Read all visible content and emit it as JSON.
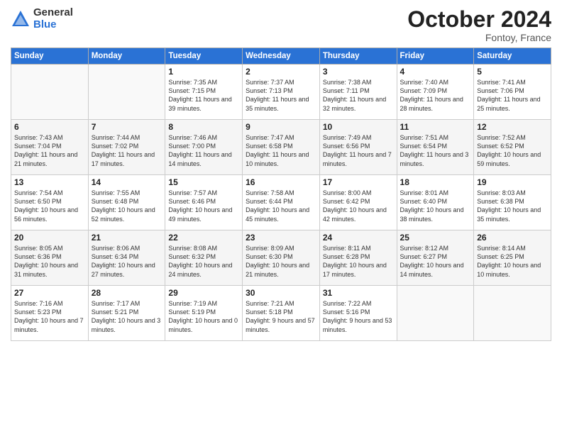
{
  "logo": {
    "general": "General",
    "blue": "Blue"
  },
  "title": "October 2024",
  "location": "Fontoy, France",
  "days_of_week": [
    "Sunday",
    "Monday",
    "Tuesday",
    "Wednesday",
    "Thursday",
    "Friday",
    "Saturday"
  ],
  "weeks": [
    [
      {
        "day": "",
        "info": ""
      },
      {
        "day": "",
        "info": ""
      },
      {
        "day": "1",
        "info": "Sunrise: 7:35 AM\nSunset: 7:15 PM\nDaylight: 11 hours and 39 minutes."
      },
      {
        "day": "2",
        "info": "Sunrise: 7:37 AM\nSunset: 7:13 PM\nDaylight: 11 hours and 35 minutes."
      },
      {
        "day": "3",
        "info": "Sunrise: 7:38 AM\nSunset: 7:11 PM\nDaylight: 11 hours and 32 minutes."
      },
      {
        "day": "4",
        "info": "Sunrise: 7:40 AM\nSunset: 7:09 PM\nDaylight: 11 hours and 28 minutes."
      },
      {
        "day": "5",
        "info": "Sunrise: 7:41 AM\nSunset: 7:06 PM\nDaylight: 11 hours and 25 minutes."
      }
    ],
    [
      {
        "day": "6",
        "info": "Sunrise: 7:43 AM\nSunset: 7:04 PM\nDaylight: 11 hours and 21 minutes."
      },
      {
        "day": "7",
        "info": "Sunrise: 7:44 AM\nSunset: 7:02 PM\nDaylight: 11 hours and 17 minutes."
      },
      {
        "day": "8",
        "info": "Sunrise: 7:46 AM\nSunset: 7:00 PM\nDaylight: 11 hours and 14 minutes."
      },
      {
        "day": "9",
        "info": "Sunrise: 7:47 AM\nSunset: 6:58 PM\nDaylight: 11 hours and 10 minutes."
      },
      {
        "day": "10",
        "info": "Sunrise: 7:49 AM\nSunset: 6:56 PM\nDaylight: 11 hours and 7 minutes."
      },
      {
        "day": "11",
        "info": "Sunrise: 7:51 AM\nSunset: 6:54 PM\nDaylight: 11 hours and 3 minutes."
      },
      {
        "day": "12",
        "info": "Sunrise: 7:52 AM\nSunset: 6:52 PM\nDaylight: 10 hours and 59 minutes."
      }
    ],
    [
      {
        "day": "13",
        "info": "Sunrise: 7:54 AM\nSunset: 6:50 PM\nDaylight: 10 hours and 56 minutes."
      },
      {
        "day": "14",
        "info": "Sunrise: 7:55 AM\nSunset: 6:48 PM\nDaylight: 10 hours and 52 minutes."
      },
      {
        "day": "15",
        "info": "Sunrise: 7:57 AM\nSunset: 6:46 PM\nDaylight: 10 hours and 49 minutes."
      },
      {
        "day": "16",
        "info": "Sunrise: 7:58 AM\nSunset: 6:44 PM\nDaylight: 10 hours and 45 minutes."
      },
      {
        "day": "17",
        "info": "Sunrise: 8:00 AM\nSunset: 6:42 PM\nDaylight: 10 hours and 42 minutes."
      },
      {
        "day": "18",
        "info": "Sunrise: 8:01 AM\nSunset: 6:40 PM\nDaylight: 10 hours and 38 minutes."
      },
      {
        "day": "19",
        "info": "Sunrise: 8:03 AM\nSunset: 6:38 PM\nDaylight: 10 hours and 35 minutes."
      }
    ],
    [
      {
        "day": "20",
        "info": "Sunrise: 8:05 AM\nSunset: 6:36 PM\nDaylight: 10 hours and 31 minutes."
      },
      {
        "day": "21",
        "info": "Sunrise: 8:06 AM\nSunset: 6:34 PM\nDaylight: 10 hours and 27 minutes."
      },
      {
        "day": "22",
        "info": "Sunrise: 8:08 AM\nSunset: 6:32 PM\nDaylight: 10 hours and 24 minutes."
      },
      {
        "day": "23",
        "info": "Sunrise: 8:09 AM\nSunset: 6:30 PM\nDaylight: 10 hours and 21 minutes."
      },
      {
        "day": "24",
        "info": "Sunrise: 8:11 AM\nSunset: 6:28 PM\nDaylight: 10 hours and 17 minutes."
      },
      {
        "day": "25",
        "info": "Sunrise: 8:12 AM\nSunset: 6:27 PM\nDaylight: 10 hours and 14 minutes."
      },
      {
        "day": "26",
        "info": "Sunrise: 8:14 AM\nSunset: 6:25 PM\nDaylight: 10 hours and 10 minutes."
      }
    ],
    [
      {
        "day": "27",
        "info": "Sunrise: 7:16 AM\nSunset: 5:23 PM\nDaylight: 10 hours and 7 minutes."
      },
      {
        "day": "28",
        "info": "Sunrise: 7:17 AM\nSunset: 5:21 PM\nDaylight: 10 hours and 3 minutes."
      },
      {
        "day": "29",
        "info": "Sunrise: 7:19 AM\nSunset: 5:19 PM\nDaylight: 10 hours and 0 minutes."
      },
      {
        "day": "30",
        "info": "Sunrise: 7:21 AM\nSunset: 5:18 PM\nDaylight: 9 hours and 57 minutes."
      },
      {
        "day": "31",
        "info": "Sunrise: 7:22 AM\nSunset: 5:16 PM\nDaylight: 9 hours and 53 minutes."
      },
      {
        "day": "",
        "info": ""
      },
      {
        "day": "",
        "info": ""
      }
    ]
  ]
}
